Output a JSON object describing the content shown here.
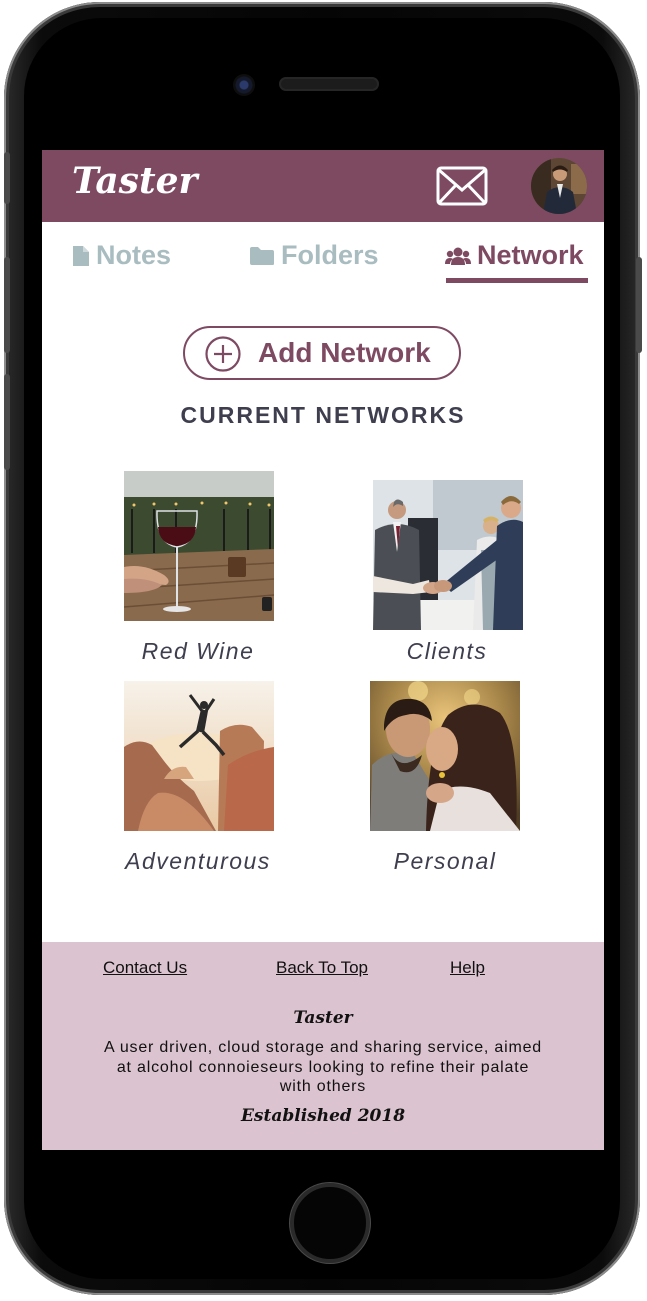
{
  "app": {
    "logo_text": "Taster"
  },
  "tabs": [
    {
      "label": "Notes",
      "icon": "file-icon",
      "active": false
    },
    {
      "label": "Folders",
      "icon": "folder-icon",
      "active": false
    },
    {
      "label": "Network",
      "icon": "users-icon",
      "active": true
    }
  ],
  "add_button": {
    "label": "Add Network",
    "icon": "plus-circle-icon"
  },
  "section_title": "CURRENT NETWORKS",
  "networks": [
    {
      "label": "Red Wine",
      "image": "wine-glass-on-table-photo"
    },
    {
      "label": "Clients",
      "image": "business-handshake-photo"
    },
    {
      "label": "Adventurous",
      "image": "person-jumping-canyon-photo"
    },
    {
      "label": "Personal",
      "image": "couple-embracing-photo"
    }
  ],
  "footer": {
    "links": [
      "Contact Us",
      "Back To Top",
      "Help"
    ],
    "brand": "Taster",
    "description": "A user driven, cloud storage and sharing service, aimed at alcohol connoieseurs looking to refine their palate with others",
    "established": "Established 2018"
  },
  "colors": {
    "primary": "#7e4a62",
    "inactive_tab": "#a9bcc0",
    "footer_bg": "#dbc3cf",
    "text_dark": "#3e3e4e"
  }
}
